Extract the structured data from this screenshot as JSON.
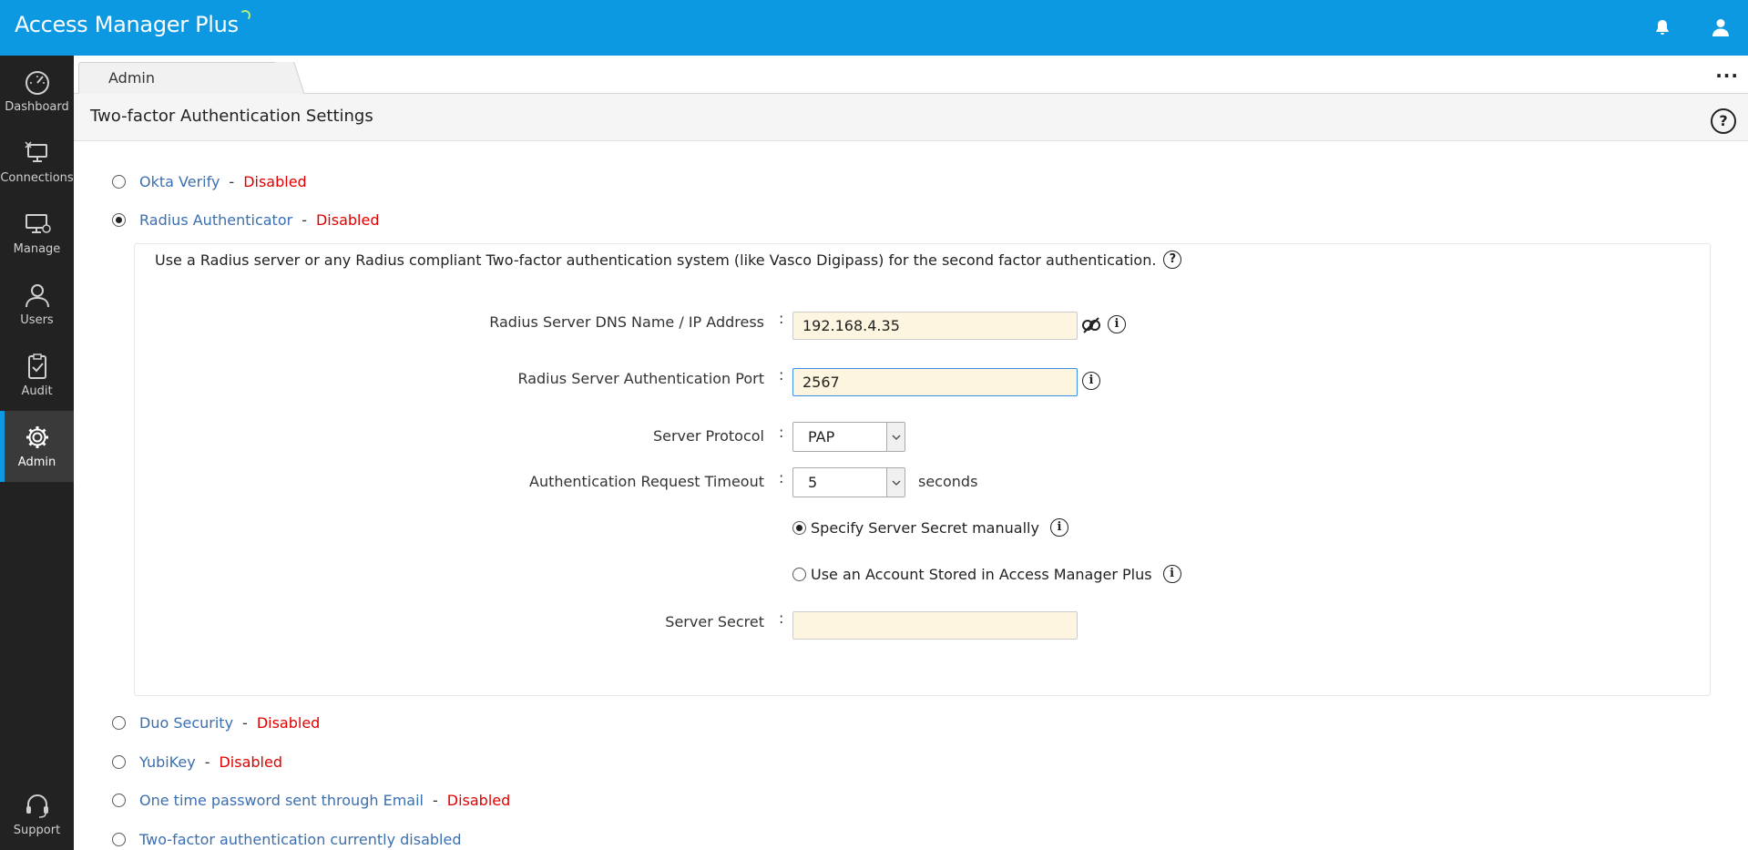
{
  "app": {
    "title": "Access Manager Plus"
  },
  "topbar": {
    "notifications_icon": "bell-icon",
    "user_icon": "user-icon"
  },
  "sidebar": {
    "items": [
      {
        "label": "Dashboard",
        "icon": "gauge-icon"
      },
      {
        "label": "Connections",
        "icon": "connections-icon"
      },
      {
        "label": "Manage",
        "icon": "manage-icon"
      },
      {
        "label": "Users",
        "icon": "user-icon"
      },
      {
        "label": "Audit",
        "icon": "clipboard-check-icon"
      },
      {
        "label": "Admin",
        "icon": "gear-icon",
        "active": true
      }
    ],
    "support": {
      "label": "Support",
      "icon": "headset-icon"
    }
  },
  "tabs": {
    "active": "Admin",
    "more": "···"
  },
  "page": {
    "title": "Two-factor Authentication Settings",
    "help": "?"
  },
  "options": [
    {
      "name": "Okta Verify",
      "separator": "-",
      "status": "Disabled",
      "checked": false
    },
    {
      "name": "Radius Authenticator",
      "separator": "-",
      "status": "Disabled",
      "checked": true
    },
    {
      "name": "Duo Security",
      "separator": "-",
      "status": "Disabled",
      "checked": false
    },
    {
      "name": "YubiKey",
      "separator": "-",
      "status": "Disabled",
      "checked": false
    },
    {
      "name": "One time password sent through Email",
      "separator": "-",
      "status": "Disabled",
      "checked": false
    },
    {
      "name": "Two-factor authentication currently disabled",
      "separator": "",
      "status": "",
      "checked": false
    }
  ],
  "radius": {
    "description": "Use a Radius server or any Radius compliant Two-factor authentication system (like Vasco Digipass) for the second factor authentication.",
    "colon": ":",
    "info": "i",
    "fields": {
      "server_dns": {
        "label": "Radius Server DNS Name / IP Address",
        "value": "192.168.4.35"
      },
      "auth_port": {
        "label": "Radius Server Authentication Port",
        "value": "2567"
      },
      "protocol": {
        "label": "Server Protocol",
        "value": "PAP"
      },
      "timeout": {
        "label": "Authentication Request Timeout",
        "value": "5",
        "suffix": "seconds"
      },
      "secret_manual": {
        "label": "Specify Server Secret manually",
        "checked": true
      },
      "secret_account": {
        "label": "Use an Account Stored in Access Manager Plus",
        "checked": false
      },
      "server_secret": {
        "label": "Server Secret",
        "value": ""
      }
    }
  },
  "colors": {
    "accent": "#0d99e2",
    "sidebar": "#222222",
    "link": "#3a6fb0",
    "disabled": "#e00000",
    "input_bg": "#fdf5df"
  }
}
